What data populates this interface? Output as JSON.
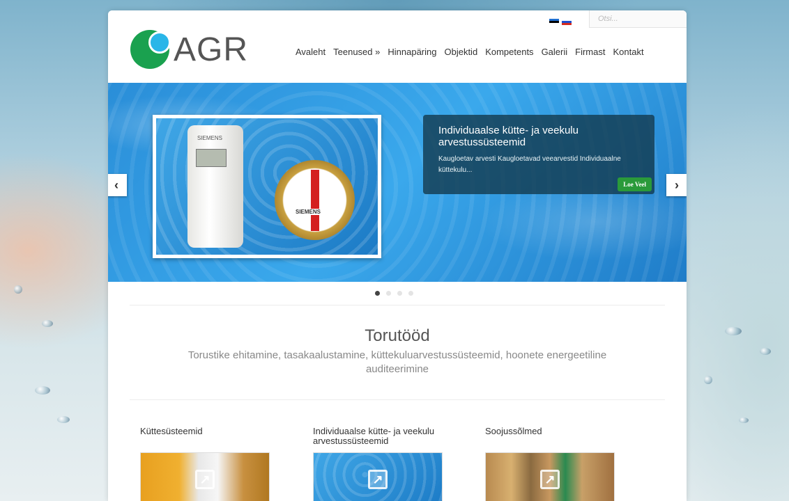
{
  "header": {
    "logo_text": "AGR",
    "search_placeholder": "Otsi...",
    "flags": [
      "flag-estonia",
      "flag-russia"
    ]
  },
  "nav": {
    "items": [
      "Avaleht",
      "Teenused »",
      "Hinnapäring",
      "Objektid",
      "Kompetents",
      "Galerii",
      "Firmast",
      "Kontakt"
    ]
  },
  "slider": {
    "caption_title": "Individuaalse kütte- ja veekulu arvestussüsteemid",
    "caption_text": "Kaugloetav arvesti Kaugloetavad veearvestid Individuaalne küttekulu...",
    "button_label": "Loe Veel",
    "prev_icon": "‹",
    "next_icon": "›",
    "image_brand_1": "SIEMENS",
    "image_brand_2": "SIEMENS",
    "dots_count": 4,
    "active_dot": 0
  },
  "intro": {
    "title": "Torutööd",
    "subtitle": "Torustike ehitamine, tasakaalustamine, küttekuluarvestussüsteemid, hoonete energeetiline auditeerimine"
  },
  "cards": [
    {
      "title": "Küttesüsteemid",
      "icon": "external-link-icon"
    },
    {
      "title": "Individuaalse kütte- ja veekulu arvestussüsteemid",
      "icon": "external-link-icon"
    },
    {
      "title": "Soojussõlmed",
      "icon": "external-link-icon"
    }
  ],
  "colors": {
    "accent_green": "#2a9a3a",
    "logo_green": "#1aa14f",
    "logo_blue": "#29b6e8",
    "caption_bg": "#143c50"
  }
}
